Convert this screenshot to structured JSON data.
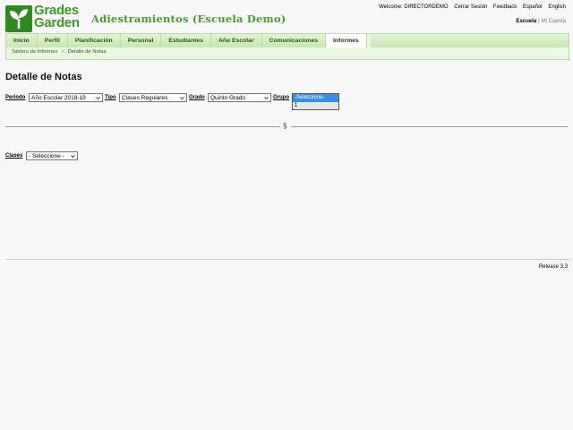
{
  "logo": {
    "line1": "Grades",
    "line2": "Garden"
  },
  "app_title": "Adiestramientos (Escuela Demo)",
  "top_links": [
    "Welcome: DIRECTORDEMO",
    "Cerrar Sesión",
    "Feedback",
    "Español",
    "English"
  ],
  "school_links": {
    "current": "Escuela",
    "separator": "|",
    "other": "Mi Cuenta"
  },
  "nav": {
    "tabs": [
      "Inicio",
      "Perfil",
      "Planificación",
      "Personal",
      "Estudiantes",
      "Año Escolar",
      "Comunicaciones",
      "Informes"
    ],
    "active_tab": "Informes"
  },
  "breadcrumb": {
    "parent": "Tablero de Informes",
    "separator": ">",
    "current": "Detalle de Notas"
  },
  "page_title": "Detalle de Notas",
  "filters": {
    "periodo": {
      "label": "Periodo",
      "value": "Año Escolar 2018-19"
    },
    "tipo": {
      "label": "Tipo",
      "value": "Clases Regulares"
    },
    "grado": {
      "label": "Grado",
      "value": "Quinto Grado"
    },
    "grupo": {
      "label": "Grupo",
      "options": [
        "-Seleccione-",
        "1"
      ],
      "highlighted": "-Seleccione-"
    }
  },
  "divider_mark": "§",
  "clases": {
    "label": "Clases",
    "value": "- Seleccione -"
  },
  "release": "Release 3.3",
  "colors": {
    "brand_green": "#3c9a2a",
    "nav_bg": "#c8e6b2",
    "highlight": "#3d8ee0"
  }
}
